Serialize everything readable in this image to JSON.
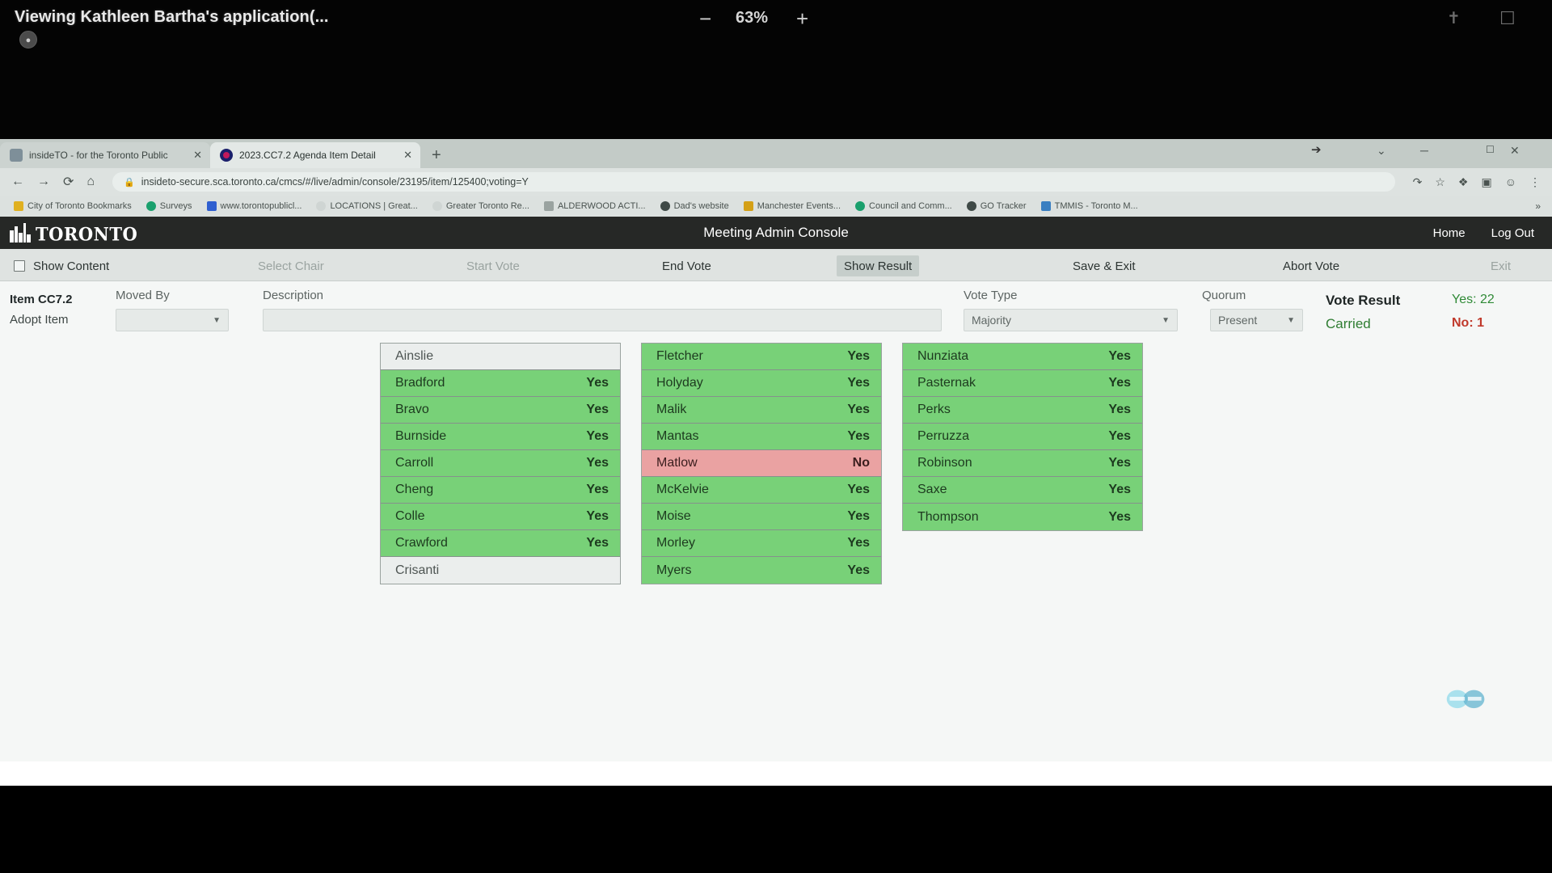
{
  "viewer": {
    "title": "Viewing Kathleen Bartha's application(...",
    "badge_icon": "person-icon",
    "zoom_out_label": "−",
    "zoom_level": "63%",
    "zoom_in_label": "+",
    "icons": [
      "signature-icon",
      "present-screen-icon"
    ]
  },
  "browser": {
    "tabs": [
      {
        "title": "insideTO - for the Toronto Public",
        "favicon": "document-favicon",
        "close_label": "✕",
        "active": false
      },
      {
        "title": "2023.CC7.2 Agenda Item Detail",
        "favicon": "toronto-favicon",
        "close_label": "✕",
        "active": true
      }
    ],
    "new_tab_label": "+",
    "window_controls": {
      "chevron": "⌄",
      "minimize": "─",
      "maximize": "☐",
      "close": "✕"
    },
    "nav": {
      "back": "←",
      "forward": "→",
      "reload": "⟳",
      "home": "⌂",
      "lock": "🔒",
      "url": "insideto-secure.sca.toronto.ca/cmcs/#/live/admin/console/23195/item/125400;voting=Y",
      "right_icons": [
        "share-icon",
        "star-icon",
        "extension-icon",
        "window-icon",
        "profile-icon",
        "menu-icon"
      ]
    },
    "bookmarks": [
      {
        "label": "City of Toronto Bookmarks",
        "color": "#e0b020"
      },
      {
        "label": "Surveys",
        "color": "#1aa06d"
      },
      {
        "label": "www.torontopublicl...",
        "color": "#2f5fd0"
      },
      {
        "label": "LOCATIONS | Great...",
        "color": "#b9bfbd"
      },
      {
        "label": "Greater Toronto Re...",
        "color": "#b9bfbd"
      },
      {
        "label": "ALDERWOOD ACTI...",
        "color": "#9aa3a0"
      },
      {
        "label": "Dad's website",
        "color": "#3f4a47"
      },
      {
        "label": "Manchester Events...",
        "color": "#d4a017"
      },
      {
        "label": "Council and Comm...",
        "color": "#1aa06d"
      },
      {
        "label": "GO Tracker",
        "color": "#3f4a47"
      },
      {
        "label": "TMMIS - Toronto M...",
        "color": "#3a7fc1"
      }
    ],
    "bookmarks_overflow": "»"
  },
  "app": {
    "brand": "TORONTO",
    "title": "Meeting Admin Console",
    "header_links": [
      "Home",
      "Log Out"
    ],
    "toolbar": [
      {
        "label": "Show Content",
        "state": "enabled",
        "checkbox": true
      },
      {
        "label": "Select Chair",
        "state": "disabled",
        "checkbox": false
      },
      {
        "label": "Start Vote",
        "state": "disabled",
        "checkbox": false
      },
      {
        "label": "End Vote",
        "state": "enabled",
        "checkbox": false
      },
      {
        "label": "Show Result",
        "state": "pressed",
        "checkbox": false
      },
      {
        "label": "Save & Exit",
        "state": "enabled",
        "checkbox": false
      },
      {
        "label": "Abort Vote",
        "state": "enabled",
        "checkbox": false
      },
      {
        "label": "Exit",
        "state": "disabled",
        "checkbox": false
      }
    ],
    "meta": {
      "item_number": "Item CC7.2",
      "item_action": "Adopt Item",
      "moved_by_label": "Moved By",
      "moved_by_value": "",
      "description_label": "Description",
      "description_value": "",
      "vote_type_label": "Vote Type",
      "vote_type_value": "Majority",
      "quorum_label": "Quorum",
      "quorum_value": "Present",
      "vote_result_label": "Vote Result",
      "vote_result_value": "Carried",
      "yes_count": "Yes: 22",
      "no_count": "No: 1"
    }
  },
  "votes": {
    "columns": [
      [
        {
          "name": "Ainslie",
          "vote": ""
        },
        {
          "name": "Bradford",
          "vote": "Yes"
        },
        {
          "name": "Bravo",
          "vote": "Yes"
        },
        {
          "name": "Burnside",
          "vote": "Yes"
        },
        {
          "name": "Carroll",
          "vote": "Yes"
        },
        {
          "name": "Cheng",
          "vote": "Yes"
        },
        {
          "name": "Colle",
          "vote": "Yes"
        },
        {
          "name": "Crawford",
          "vote": "Yes"
        },
        {
          "name": "Crisanti",
          "vote": ""
        }
      ],
      [
        {
          "name": "Fletcher",
          "vote": "Yes"
        },
        {
          "name": "Holyday",
          "vote": "Yes"
        },
        {
          "name": "Malik",
          "vote": "Yes"
        },
        {
          "name": "Mantas",
          "vote": "Yes"
        },
        {
          "name": "Matlow",
          "vote": "No"
        },
        {
          "name": "McKelvie",
          "vote": "Yes"
        },
        {
          "name": "Moise",
          "vote": "Yes"
        },
        {
          "name": "Morley",
          "vote": "Yes"
        },
        {
          "name": "Myers",
          "vote": "Yes"
        }
      ],
      [
        {
          "name": "Nunziata",
          "vote": "Yes"
        },
        {
          "name": "Pasternak",
          "vote": "Yes"
        },
        {
          "name": "Perks",
          "vote": "Yes"
        },
        {
          "name": "Perruzza",
          "vote": "Yes"
        },
        {
          "name": "Robinson",
          "vote": "Yes"
        },
        {
          "name": "Saxe",
          "vote": "Yes"
        },
        {
          "name": "Thompson",
          "vote": "Yes"
        }
      ]
    ]
  },
  "colors": {
    "yes_bg": "#78d178",
    "no_bg": "#eaa2a2",
    "none_bg": "#ebeeed",
    "carried": "#2f7d32",
    "no_text": "#c0392b",
    "header_bg": "#262826"
  }
}
